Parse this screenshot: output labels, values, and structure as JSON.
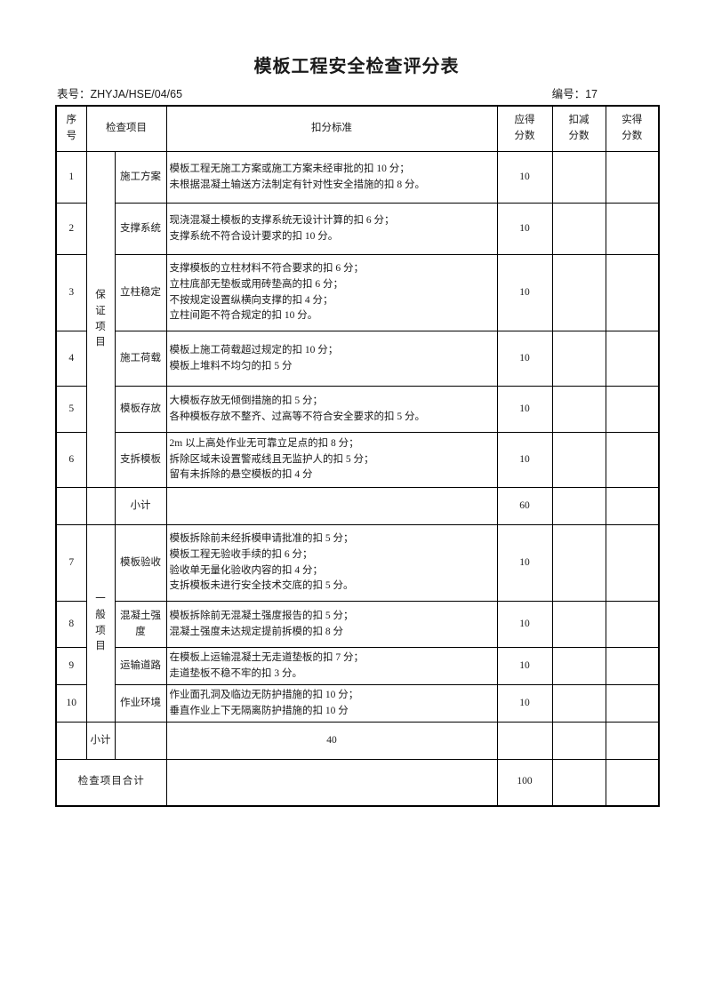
{
  "document": {
    "title": "模板工程安全检查评分表",
    "form_number_label": "表号：",
    "form_number_value": "ZHYJA/HSE/04/65",
    "serial_label": "编号：",
    "serial_value": "17"
  },
  "table": {
    "headers": {
      "no_line1": "序",
      "no_line2": "号",
      "inspection_item": "检查项目",
      "deduction_standard": "扣分标准",
      "due_line1": "应得",
      "due_line2": "分数",
      "deducted_line1": "扣减",
      "deducted_line2": "分数",
      "actual_line1": "实得",
      "actual_line2": "分数"
    },
    "categories": {
      "guarantee": [
        "保",
        "证",
        "项",
        "目"
      ],
      "general": [
        "一",
        "般",
        "项",
        "目"
      ]
    },
    "rows": [
      {
        "no": "1",
        "item": "施工方案",
        "criteria": [
          "模板工程无施工方案或施工方案未经审批的扣 10 分；",
          "未根据混凝土输送方法制定有针对性安全措施的扣 8 分。"
        ],
        "due": "10",
        "deducted": "",
        "actual": ""
      },
      {
        "no": "2",
        "item": "支撑系统",
        "criteria": [
          "现浇混凝土模板的支撑系统无设计计算的扣 6 分；",
          "支撑系统不符合设计要求的扣 10 分。"
        ],
        "due": "10",
        "deducted": "",
        "actual": ""
      },
      {
        "no": "3",
        "item": "立柱稳定",
        "criteria": [
          "支撑模板的立柱材料不符合要求的扣 6 分；",
          "立柱底部无垫板或用砖垫高的扣 6 分；",
          "不按规定设置纵横向支撑的扣 4 分；",
          "立柱间距不符合规定的扣 10 分。"
        ],
        "due": "10",
        "deducted": "",
        "actual": ""
      },
      {
        "no": "4",
        "item": "施工荷载",
        "criteria": [
          "模板上施工荷载超过规定的扣 10 分；",
          "模板上堆料不均匀的扣 5 分"
        ],
        "due": "10",
        "deducted": "",
        "actual": ""
      },
      {
        "no": "5",
        "item": "模板存放",
        "criteria": [
          "大模板存放无倾倒措施的扣 5 分；",
          "各种模板存放不整齐、过高等不符合安全要求的扣 5 分。"
        ],
        "due": "10",
        "deducted": "",
        "actual": ""
      },
      {
        "no": "6",
        "item": "支拆模板",
        "criteria": [
          "2m 以上高处作业无可靠立足点的扣 8 分；",
          "拆除区域未设置警戒线且无监护人的扣 5 分；",
          "留有未拆除的悬空模板的扣 4 分"
        ],
        "due": "10",
        "deducted": "",
        "actual": ""
      },
      {
        "no": "7",
        "item": "模板验收",
        "criteria": [
          "模板拆除前未经拆模申请批准的扣 5 分；",
          "模板工程无验收手续的扣 6 分；",
          "验收单无量化验收内容的扣 4 分；",
          "支拆模板未进行安全技术交底的扣 5 分。"
        ],
        "due": "10",
        "deducted": "",
        "actual": ""
      },
      {
        "no": "8",
        "item": "混凝土强度",
        "criteria": [
          "模板拆除前无混凝土强度报告的扣 5 分；",
          "混凝土强度未达规定提前拆模的扣 8 分"
        ],
        "due": "10",
        "deducted": "",
        "actual": ""
      },
      {
        "no": "9",
        "item": "运输道路",
        "criteria": [
          "在模板上运输混凝土无走道垫板的扣 7 分；",
          "走道垫板不稳不牢的扣 3 分。"
        ],
        "due": "10",
        "deducted": "",
        "actual": ""
      },
      {
        "no": "10",
        "item": "作业环境",
        "criteria": [
          "作业面孔洞及临边无防护措施的扣 10 分；",
          "垂直作业上下无隔离防护措施的扣 10 分"
        ],
        "due": "10",
        "deducted": "",
        "actual": ""
      }
    ],
    "subtotal_guarantee": {
      "label": "小计",
      "due": "60",
      "deducted": "",
      "actual": ""
    },
    "subtotal_general": {
      "label": "小计",
      "due": "40",
      "deducted": "",
      "actual": ""
    },
    "grand_total": {
      "label": "检查项目合计",
      "due": "100",
      "deducted": "",
      "actual": ""
    }
  }
}
